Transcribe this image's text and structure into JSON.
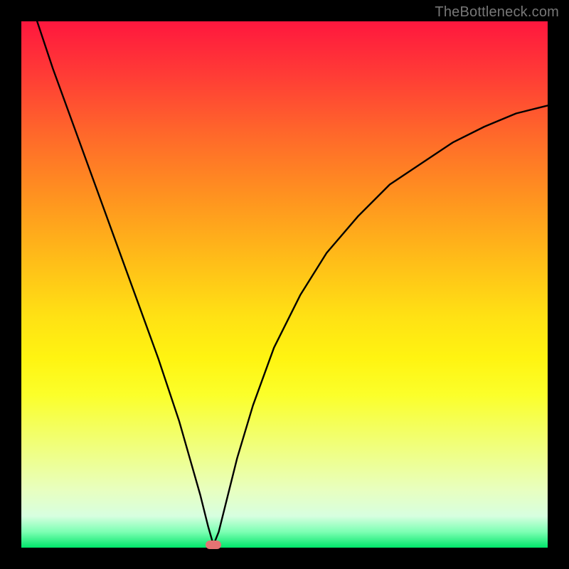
{
  "watermark": "TheBottleneck.com",
  "chart_data": {
    "type": "line",
    "title": "",
    "xlabel": "",
    "ylabel": "",
    "xlim": [
      0,
      100
    ],
    "ylim": [
      0,
      100
    ],
    "grid": false,
    "legend": false,
    "background": "rainbow-gradient (red top, green bottom)",
    "series": [
      {
        "name": "bottleneck-curve",
        "color": "#000000",
        "x": [
          3,
          6,
          10,
          14,
          18,
          22,
          26,
          30,
          32,
          34,
          35.5,
          36.5,
          37.5,
          39,
          41,
          44,
          48,
          53,
          58,
          64,
          70,
          76,
          82,
          88,
          94,
          100
        ],
        "y": [
          100,
          91,
          80,
          69,
          58,
          47,
          36,
          24,
          17,
          10,
          4,
          0.5,
          3,
          9,
          17,
          27,
          38,
          48,
          56,
          63,
          69,
          73,
          77,
          80,
          82.5,
          84
        ]
      }
    ],
    "marker": {
      "x": 36.5,
      "y": 0.5,
      "color": "#e57373"
    }
  }
}
